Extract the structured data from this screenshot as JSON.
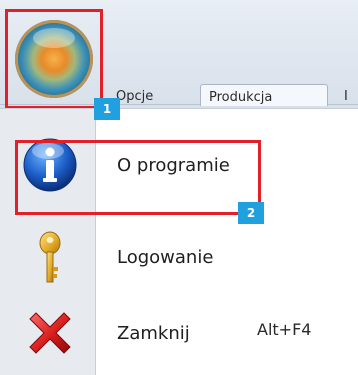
{
  "ribbon": {
    "tabs": [
      {
        "label": "Opcje"
      },
      {
        "label": "Produkcja"
      },
      {
        "label": "I"
      }
    ]
  },
  "app_menu": {
    "items": [
      {
        "label": "O programie",
        "icon": "info-icon"
      },
      {
        "label": "Logowanie",
        "icon": "key-icon"
      },
      {
        "label": "Zamknij",
        "icon": "close-x-icon",
        "shortcut": "Alt+F4"
      }
    ]
  },
  "annotations": {
    "badge_1": "1",
    "badge_2": "2",
    "highlight_color": "#e2202a",
    "badge_color": "#20a0df"
  }
}
